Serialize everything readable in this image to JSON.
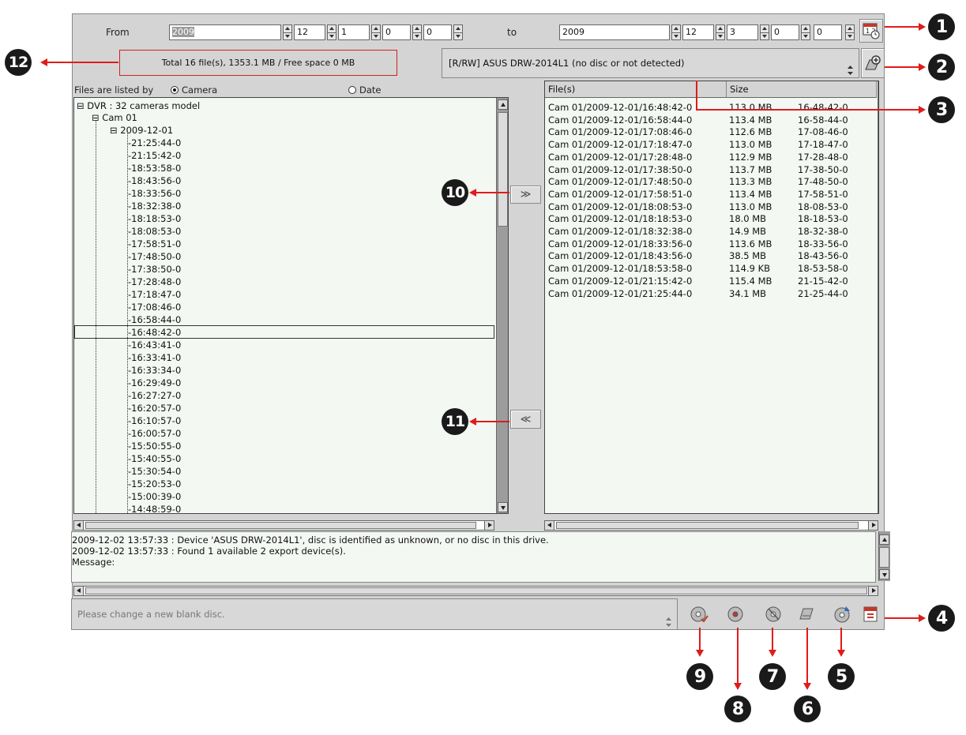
{
  "date_range": {
    "from_label": "From",
    "to_label": "to",
    "from": {
      "year": "2009",
      "month": "12",
      "day": "1",
      "hour": "0",
      "minute": "0"
    },
    "to": {
      "year": "2009",
      "month": "12",
      "day": "3",
      "hour": "0",
      "minute": "0"
    }
  },
  "summary": "Total 16 file(s), 1353.1 MB / Free space 0 MB",
  "device": "[R/RW] ASUS DRW-2014L1 (no disc or not detected)",
  "list_by": {
    "label": "Files are listed by",
    "options": [
      "Camera",
      "Date"
    ],
    "selected": "Camera"
  },
  "tree": {
    "root": "DVR : 32 cameras model",
    "camera": "Cam 01",
    "date": "2009-12-01",
    "entries": [
      "21:25:44-0",
      "21:15:42-0",
      "18:53:58-0",
      "18:43:56-0",
      "18:33:56-0",
      "18:32:38-0",
      "18:18:53-0",
      "18:08:53-0",
      "17:58:51-0",
      "17:48:50-0",
      "17:38:50-0",
      "17:28:48-0",
      "17:18:47-0",
      "17:08:46-0",
      "16:58:44-0",
      "16:48:42-0",
      "16:43:41-0",
      "16:33:41-0",
      "16:33:34-0",
      "16:29:49-0",
      "16:27:27-0",
      "16:20:57-0",
      "16:10:57-0",
      "16:00:57-0",
      "15:50:55-0",
      "15:40:55-0",
      "15:30:54-0",
      "15:20:53-0",
      "15:00:39-0",
      "14:48:59-0"
    ],
    "selected_entry": "16:48:42-0"
  },
  "transfer": {
    "add": "≫",
    "remove": "≪"
  },
  "files_table": {
    "columns": [
      "File(s)",
      "Size"
    ],
    "rows": [
      [
        "Cam 01/2009-12-01/16:48:42-0",
        "113.0 MB",
        "16-48-42-0"
      ],
      [
        "Cam 01/2009-12-01/16:58:44-0",
        "113.4 MB",
        "16-58-44-0"
      ],
      [
        "Cam 01/2009-12-01/17:08:46-0",
        "112.6 MB",
        "17-08-46-0"
      ],
      [
        "Cam 01/2009-12-01/17:18:47-0",
        "113.0 MB",
        "17-18-47-0"
      ],
      [
        "Cam 01/2009-12-01/17:28:48-0",
        "112.9 MB",
        "17-28-48-0"
      ],
      [
        "Cam 01/2009-12-01/17:38:50-0",
        "113.7 MB",
        "17-38-50-0"
      ],
      [
        "Cam 01/2009-12-01/17:48:50-0",
        "113.3 MB",
        "17-48-50-0"
      ],
      [
        "Cam 01/2009-12-01/17:58:51-0",
        "113.4 MB",
        "17-58-51-0"
      ],
      [
        "Cam 01/2009-12-01/18:08:53-0",
        "113.0 MB",
        "18-08-53-0"
      ],
      [
        "Cam 01/2009-12-01/18:18:53-0",
        "18.0 MB",
        "18-18-53-0"
      ],
      [
        "Cam 01/2009-12-01/18:32:38-0",
        "14.9 MB",
        "18-32-38-0"
      ],
      [
        "Cam 01/2009-12-01/18:33:56-0",
        "113.6 MB",
        "18-33-56-0"
      ],
      [
        "Cam 01/2009-12-01/18:43:56-0",
        "38.5 MB",
        "18-43-56-0"
      ],
      [
        "Cam 01/2009-12-01/18:53:58-0",
        "114.9 KB",
        "18-53-58-0"
      ],
      [
        "Cam 01/2009-12-01/21:15:42-0",
        "115.4 MB",
        "21-15-42-0"
      ],
      [
        "Cam 01/2009-12-01/21:25:44-0",
        "34.1 MB",
        "21-25-44-0"
      ]
    ]
  },
  "log": [
    "2009-12-02 13:57:33 : Device 'ASUS DRW-2014L1', disc is identified as unknown, or no disc in this drive.",
    "2009-12-02 13:57:33 : Found 1 available 2 export device(s).",
    "Message:"
  ],
  "status_message": "Please change a new blank disc.",
  "callouts": [
    "1",
    "2",
    "3",
    "4",
    "5",
    "6",
    "7",
    "8",
    "9",
    "10",
    "11",
    "12"
  ],
  "colors": {
    "window": "#d4d4d4",
    "panel": "#f3f8f3",
    "callout_line": "#e01b1b",
    "callout_badge": "#1a1a1a"
  }
}
